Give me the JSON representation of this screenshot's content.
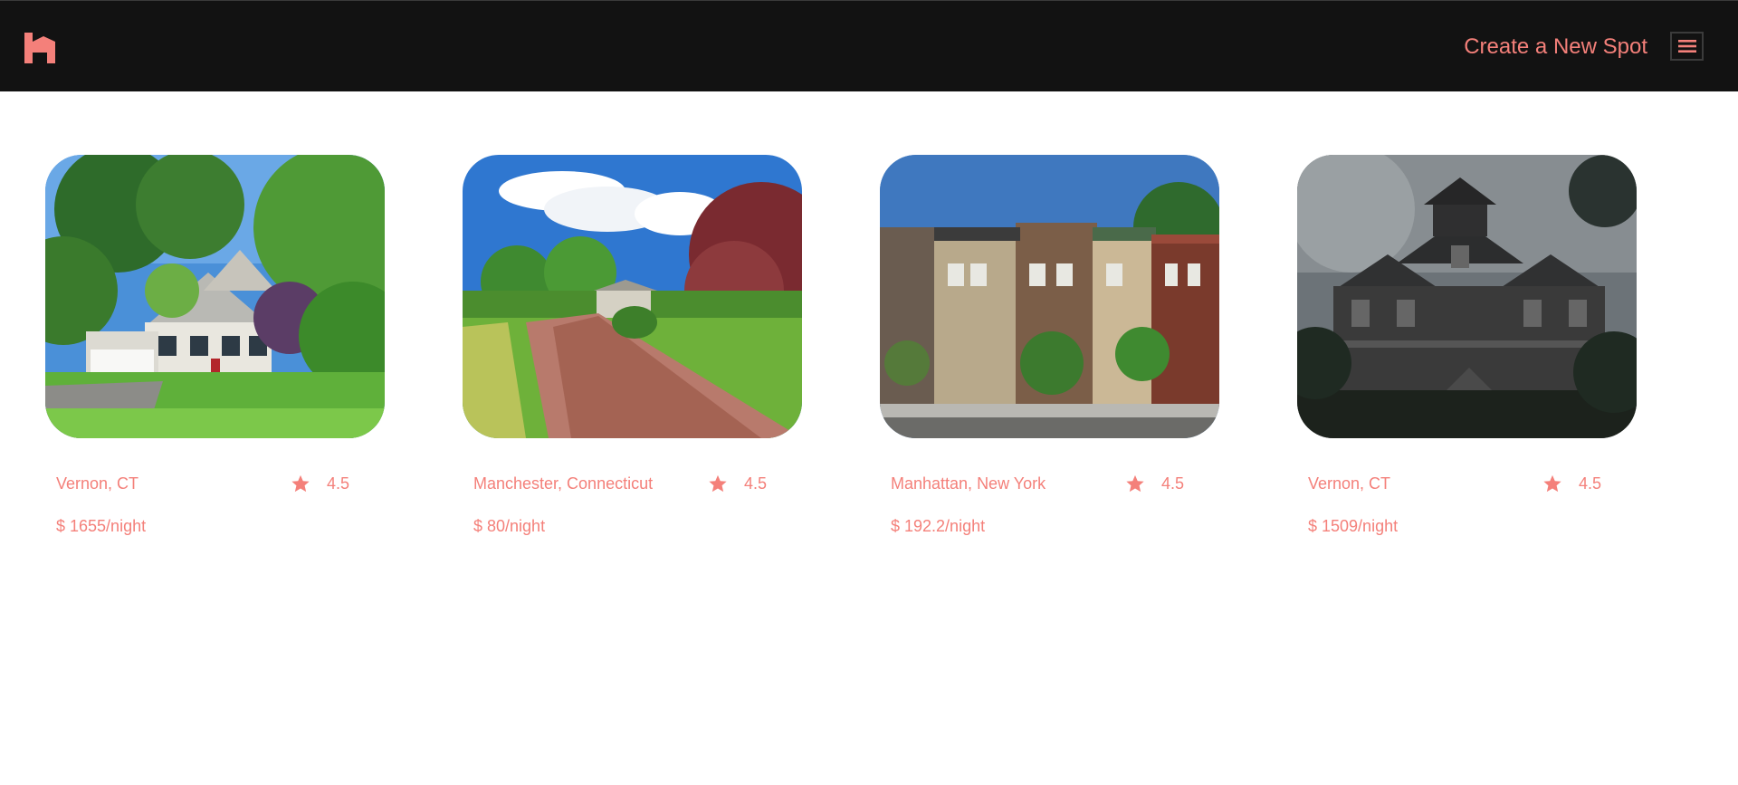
{
  "header": {
    "logo_icon": "house-logo-icon",
    "create_spot_label": "Create a New Spot",
    "menu_icon": "hamburger-menu-icon"
  },
  "theme": {
    "accent": "#f4807a",
    "header_bg": "#121212"
  },
  "spots": [
    {
      "location": "Vernon, CT",
      "rating": "4.5",
      "price": "$ 1655/night",
      "image": "white-colonial-house-photo"
    },
    {
      "location": "Manchester, Connecticut",
      "rating": "4.5",
      "price": "$ 80/night",
      "image": "brick-driveway-house-photo"
    },
    {
      "location": "Manhattan, New York",
      "rating": "4.5",
      "price": "$ 192.2/night",
      "image": "brownstone-row-houses-photo"
    },
    {
      "location": "Vernon, CT",
      "rating": "4.5",
      "price": "$ 1509/night",
      "image": "dark-victorian-mansion-photo"
    }
  ]
}
